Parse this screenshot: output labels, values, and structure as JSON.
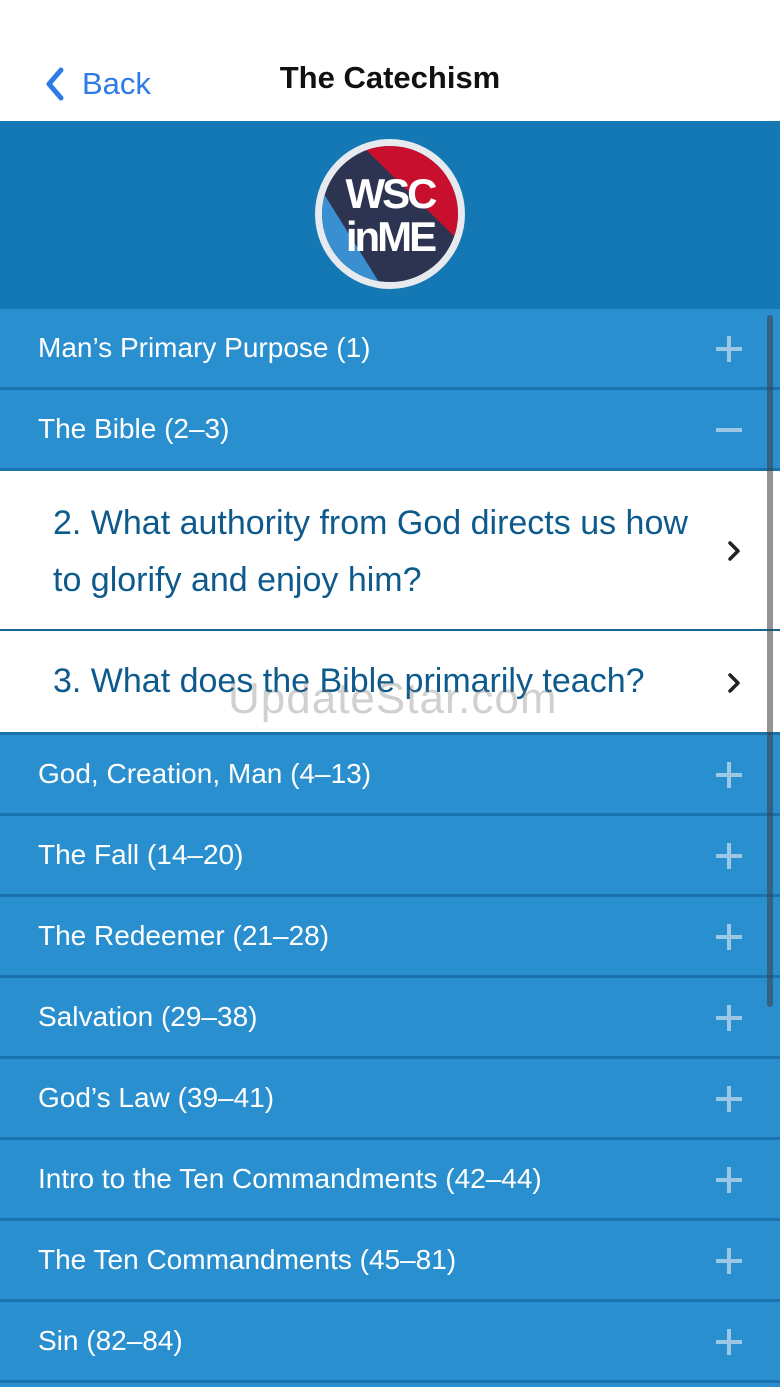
{
  "navbar": {
    "back_label": "Back",
    "title": "The Catechism"
  },
  "logo": {
    "text_line1": "WSC",
    "text_line2": "inME"
  },
  "sections": [
    {
      "label": "Man’s Primary Purpose (1)",
      "state": "collapsed"
    },
    {
      "label": "The Bible  (2–3)",
      "state": "expanded"
    },
    {
      "label": "God, Creation, Man (4–13)",
      "state": "collapsed"
    },
    {
      "label": "The Fall (14–20)",
      "state": "collapsed"
    },
    {
      "label": "The Redeemer (21–28)",
      "state": "collapsed"
    },
    {
      "label": "Salvation (29–38)",
      "state": "collapsed"
    },
    {
      "label": "God’s Law (39–41)",
      "state": "collapsed"
    },
    {
      "label": "Intro to the Ten Commandments (42–44)",
      "state": "collapsed"
    },
    {
      "label": "The Ten Commandments (45–81)",
      "state": "collapsed"
    },
    {
      "label": "Sin (82–84)",
      "state": "collapsed"
    }
  ],
  "questions": [
    {
      "text": "2. What authority from God directs us how to glorify and enjoy him?"
    },
    {
      "text": "3. What does the Bible primarily teach?"
    }
  ],
  "watermark": "UpdateStar.com",
  "colors": {
    "accent_blue": "#2D7BE5",
    "header_blue": "#1478B4",
    "row_blue": "#2A8FCE",
    "question_text": "#0E5A8C"
  }
}
